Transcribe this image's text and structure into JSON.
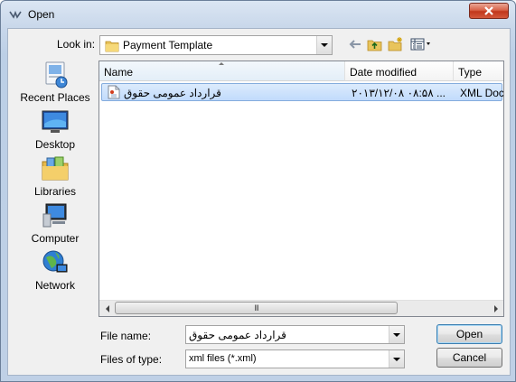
{
  "window": {
    "title": "Open"
  },
  "look_in": {
    "label": "Look in:",
    "value": "Payment Template"
  },
  "places": [
    {
      "label": "Recent Places",
      "icon": "recent-places-icon"
    },
    {
      "label": "Desktop",
      "icon": "desktop-icon"
    },
    {
      "label": "Libraries",
      "icon": "libraries-icon"
    },
    {
      "label": "Computer",
      "icon": "computer-icon"
    },
    {
      "label": "Network",
      "icon": "network-icon"
    }
  ],
  "file_list": {
    "columns": [
      "Name",
      "Date modified",
      "Type"
    ],
    "rows": [
      {
        "name": "قرارداد عمومی حقوق",
        "date": "۲۰۱۳/۱۲/۰۸ ۰۸:۵۸ ...",
        "type": "XML Docu"
      }
    ],
    "scroll_grip": "III"
  },
  "file_name": {
    "label": "File name:",
    "value": "قرارداد عمومی حقوق"
  },
  "file_type": {
    "label": "Files of type:",
    "value": "xml files (*.xml)"
  },
  "buttons": {
    "open": "Open",
    "cancel": "Cancel"
  },
  "colors": {
    "selection": "#c1dbfc",
    "close_button": "#c1371c",
    "dialog_bg": "#f0f0f0"
  }
}
